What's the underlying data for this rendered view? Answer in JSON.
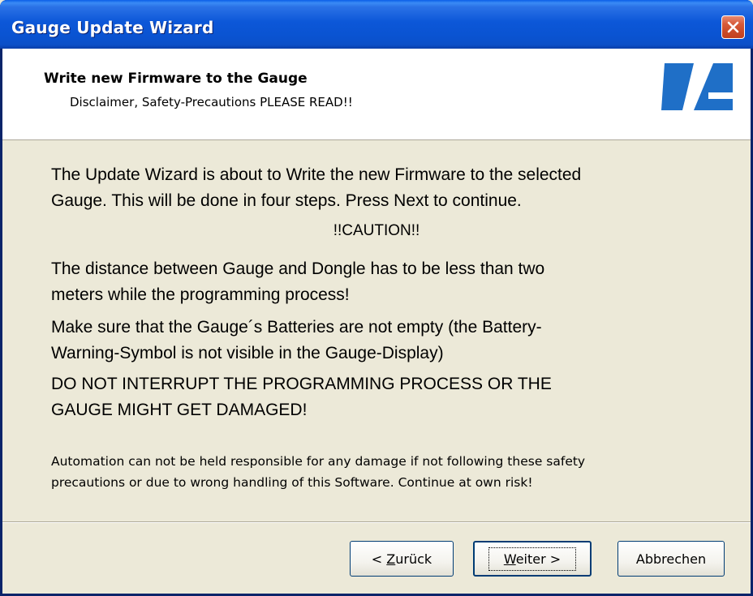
{
  "window": {
    "title": "Gauge Update Wizard",
    "close_icon": "close-icon"
  },
  "header": {
    "title": "Write new Firmware to the Gauge",
    "subtitle": "Disclaimer, Safety-Precautions PLEASE READ!!",
    "logo_icon": "company-logo-icon",
    "logo_color": "#1f6fc7"
  },
  "content": {
    "intro_line1": "The Update Wizard is about to Write the new Firmware to the selected",
    "intro_line2": "Gauge. This will be done in four steps. Press Next to continue.",
    "caution": "!!CAUTION!!",
    "distance_line1": "The distance between Gauge and Dongle has to be less than two",
    "distance_line2": "meters while the programming process!",
    "battery_line1": "Make sure that the Gauge´s Batteries are not empty (the Battery-",
    "battery_line2": "Warning-Symbol is not visible in the Gauge-Display)",
    "interrupt_line1": "DO NOT INTERRUPT THE PROGRAMMING PROCESS OR THE",
    "interrupt_line2": "GAUGE MIGHT GET DAMAGED!",
    "disclaimer_line1": "Automation can not be held responsible for any damage if not following these safety",
    "disclaimer_line2": "precautions or due to wrong handling of this Software. Continue at own risk!"
  },
  "buttons": {
    "back_prefix": "< ",
    "back_mnemonic": "Z",
    "back_rest": "urück",
    "next_mnemonic": "W",
    "next_rest": "eiter >",
    "cancel": "Abbrechen"
  },
  "colors": {
    "titlebar": "#0a53d1",
    "dialog_bg": "#ece9d8",
    "close_button": "#c94a28"
  }
}
